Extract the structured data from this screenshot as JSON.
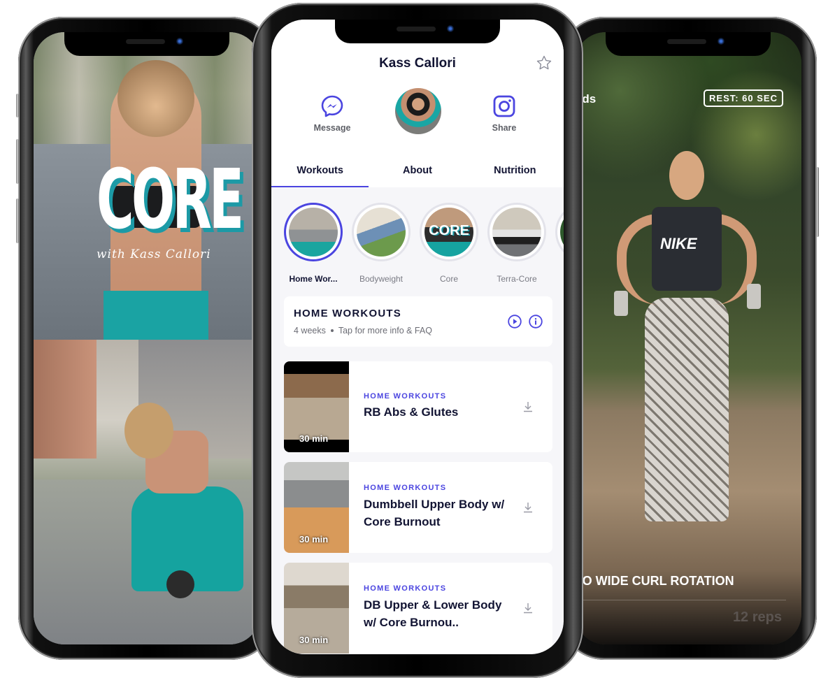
{
  "left_phone": {
    "cover_title": "CORE",
    "cover_subtitle": "with Kass Callori"
  },
  "right_phone": {
    "sets_label": "nds",
    "rest_badge": "REST: 60 SEC",
    "exercise_name": "TO WIDE CURL ROTATION",
    "reps": "12 reps",
    "shirt_logo": "NIKE"
  },
  "profile": {
    "name": "Kass Callori",
    "favorite_icon": "star-icon",
    "actions": [
      {
        "label": "Message",
        "icon": "messenger-icon"
      },
      {
        "label": "Share",
        "icon": "instagram-icon"
      }
    ]
  },
  "tabs": [
    {
      "label": "Workouts",
      "active": true
    },
    {
      "label": "About",
      "active": false
    },
    {
      "label": "Nutrition",
      "active": false
    }
  ],
  "collections": [
    {
      "label": "Home Wor...",
      "active": true
    },
    {
      "label": "Bodyweight",
      "active": false
    },
    {
      "label": "Core",
      "active": false,
      "overlay": "CORE"
    },
    {
      "label": "Terra-Core",
      "active": false
    }
  ],
  "program": {
    "title": "HOME WORKOUTS",
    "duration": "4 weeks",
    "hint": "Tap for more info & FAQ"
  },
  "workouts": [
    {
      "category": "HOME WORKOUTS",
      "title": "RB Abs & Glutes",
      "duration": "30 min"
    },
    {
      "category": "HOME WORKOUTS",
      "title": "Dumbbell Upper Body w/ Core Burnout",
      "duration": "30 min"
    },
    {
      "category": "HOME WORKOUTS",
      "title": "DB Upper & Lower Body w/ Core Burnou..",
      "duration": "30 min"
    }
  ],
  "colors": {
    "accent": "#4b45e0",
    "text_dark": "#121433",
    "text_muted": "#6c6d75",
    "background": "#f6f6f9",
    "teal": "#1c9aa6"
  }
}
